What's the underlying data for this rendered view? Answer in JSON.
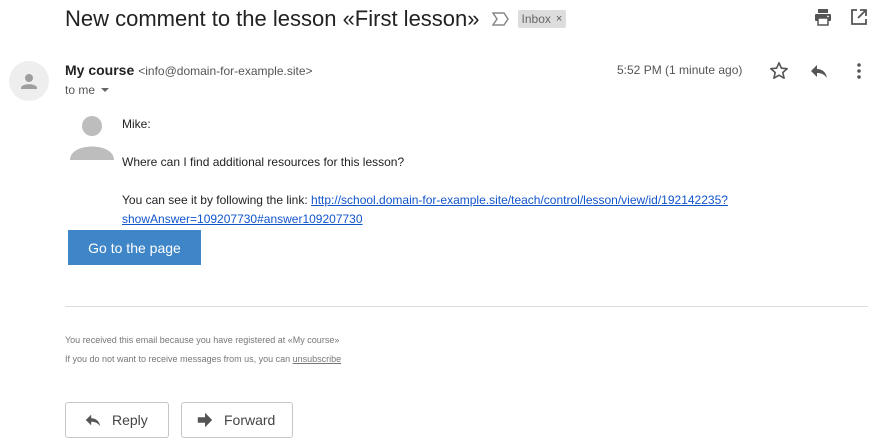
{
  "email": {
    "subject": "New comment to the lesson «First lesson»",
    "label": "Inbox",
    "label_close": "×",
    "sender_name": "My course",
    "sender_email": "<info@domain-for-example.site>",
    "to_label": "to me",
    "time": "5:52 PM (1 minute ago)"
  },
  "body": {
    "author": "Mike:",
    "question": "Where can I find additional resources for this lesson?",
    "link_intro": "You can see it by following the link: ",
    "link_line1": "http://school.domain-for-example.site/teach/control/lesson/view/id/192142235?",
    "link_line2": "showAnswer=109207730#answer109207730",
    "button_label": "Go to the page"
  },
  "footer": {
    "line1": "You received this email because you have registered at «My course»",
    "line2_prefix": "If you do not want to receive messages from us, you can ",
    "unsubscribe": "unsubscribe"
  },
  "actions": {
    "reply_label": "Reply",
    "forward_label": "Forward"
  },
  "icons": {
    "important": "important-marker-icon",
    "print": "print-icon",
    "open_new": "open-in-new-window-icon",
    "star": "star-icon",
    "reply": "reply-icon",
    "more": "more-vertical-icon",
    "forward": "forward-icon"
  },
  "colors": {
    "button_bg": "#3f86c8",
    "link": "#1155cc",
    "label_chip_bg": "#dddddd"
  }
}
